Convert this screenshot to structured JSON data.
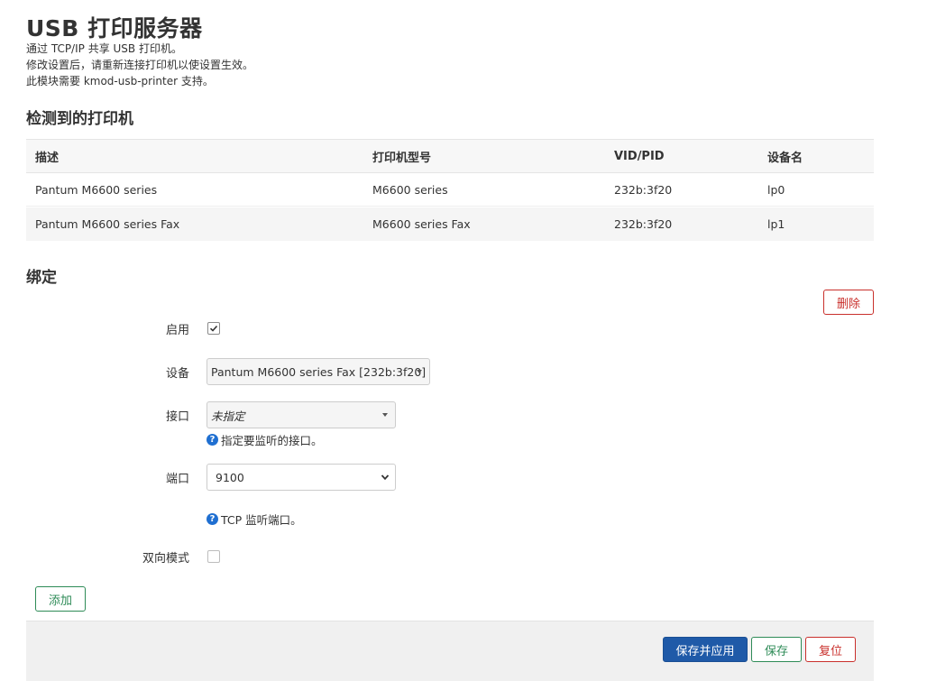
{
  "header": {
    "title": "USB 打印服务器",
    "desc_lines": [
      "通过 TCP/IP 共享 USB 打印机。",
      "修改设置后，请重新连接打印机以使设置生效。",
      "此模块需要 kmod-usb-printer 支持。"
    ]
  },
  "detected": {
    "title": "检测到的打印机",
    "columns": [
      "描述",
      "打印机型号",
      "VID/PID",
      "设备名"
    ],
    "rows": [
      [
        "Pantum M6600 series",
        "M6600 series",
        "232b:3f20",
        "lp0"
      ],
      [
        "Pantum M6600 series Fax",
        "M6600 series Fax",
        "232b:3f20",
        "lp1"
      ]
    ]
  },
  "binding": {
    "title": "绑定",
    "delete_label": "删除",
    "enable_label": "启用",
    "enable_checked": true,
    "device_label": "设备",
    "device_value": "Pantum M6600 series Fax [232b:3f20]",
    "interface_label": "接口",
    "interface_value": "未指定",
    "interface_hint": "指定要监听的接口。",
    "port_label": "端口",
    "port_value": "9100",
    "port_hint": "TCP 监听端口。",
    "bidir_label": "双向模式",
    "bidir_checked": false,
    "add_label": "添加"
  },
  "footer": {
    "apply_label": "保存并应用",
    "save_label": "保存",
    "reset_label": "复位"
  },
  "icons": {
    "info": "info-icon",
    "check": "check-icon",
    "caret": "caret-down-icon",
    "chevron": "chevron-down-icon"
  },
  "colors": {
    "primary": "#1f5aa8",
    "positive": "#2e8b57",
    "negative": "#c9302c",
    "info": "#1f6fd1"
  }
}
